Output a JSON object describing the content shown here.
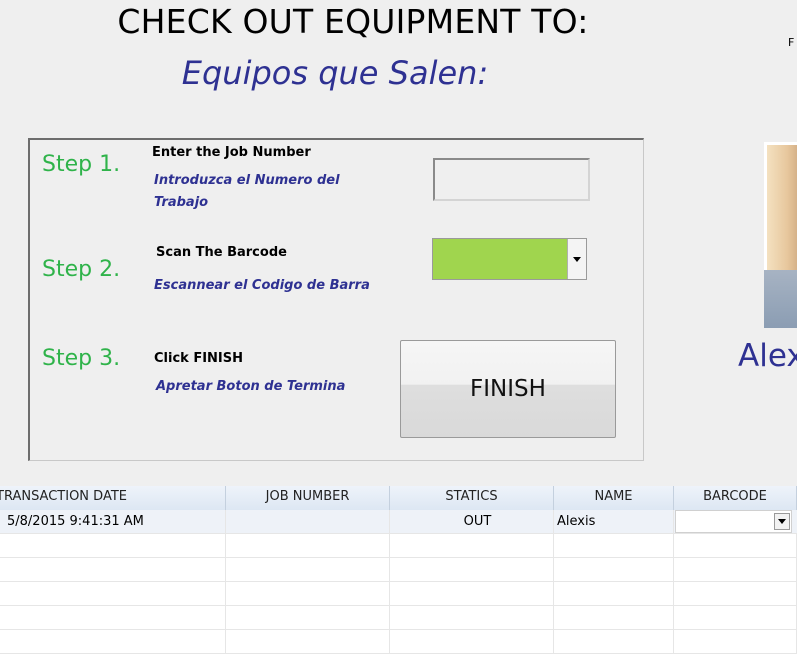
{
  "header": {
    "title_en": "CHECK OUT EQUIPMENT TO:",
    "title_es": "Equipos que Salen:",
    "corner_text": "F"
  },
  "steps": [
    {
      "label": "Step 1.",
      "instruction_en": "Enter the Job Number",
      "instruction_es": "Introduzca el Numero del Trabajo"
    },
    {
      "label": "Step 2.",
      "instruction_en": "Scan The Barcode",
      "instruction_es": "Escannear el Codigo de Barra"
    },
    {
      "label": "Step 3.",
      "instruction_en": "Click  FINISH",
      "instruction_es": "Apretar Boton de Termina"
    }
  ],
  "job_number": {
    "value": ""
  },
  "barcode_select": {
    "value": ""
  },
  "finish_button": {
    "label": "FINISH"
  },
  "person": {
    "name_visible": "Alex"
  },
  "table": {
    "columns": [
      "TRANSACTION DATE",
      "JOB NUMBER",
      "STATICS",
      "NAME",
      "BARCODE"
    ],
    "rows": [
      {
        "transaction_date": "5/8/2015 9:41:31 AM",
        "job_number": "",
        "statics": "OUT",
        "name": "Alexis",
        "barcode": ""
      }
    ]
  },
  "colors": {
    "step_green": "#2fb34a",
    "spanish_blue": "#2e3192",
    "barcode_field": "#a0d54e"
  }
}
